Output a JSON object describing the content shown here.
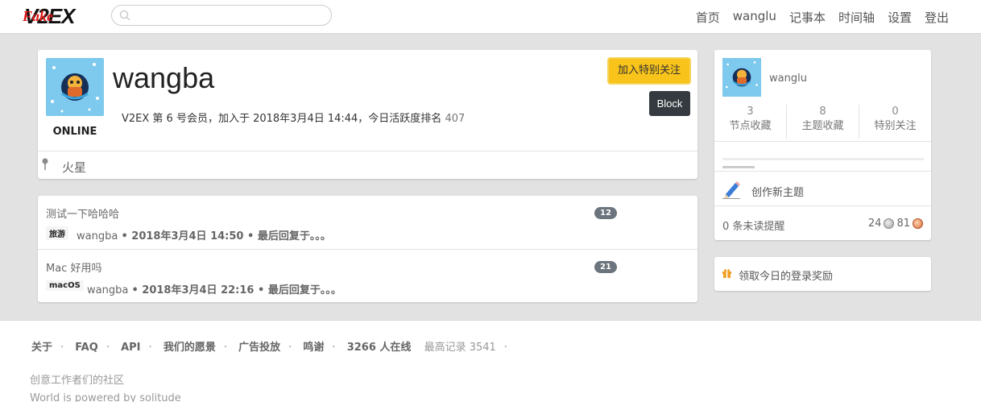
{
  "header": {
    "logo_text": "V2EX",
    "logo_overlay": "Fake",
    "search_placeholder": "",
    "nav": [
      "首页",
      "wanglu",
      "记事本",
      "时间轴",
      "设置",
      "登出"
    ]
  },
  "profile": {
    "username": "wangba",
    "status": "ONLINE",
    "meta_text": "V2EX 第 6 号会员，加入于 2018年3月4日 14:44，今日活跃度排名",
    "rank": "407",
    "follow_label": "加入特别关注",
    "block_label": "Block",
    "location": "火星"
  },
  "topics": [
    {
      "title": "测试一下哈哈哈",
      "replies": "12",
      "node": "旅游",
      "author": "wangba",
      "detail": "• 2018年3月4日 14:50 • 最后回复于。。。"
    },
    {
      "title": "Mac 好用吗",
      "replies": "21",
      "node": "macOS",
      "author": "wangba",
      "detail": "• 2018年3月4日 22:16 • 最后回复于。。。"
    }
  ],
  "sidebar": {
    "username": "wanglu",
    "stats": [
      {
        "num": "3",
        "label": "节点收藏"
      },
      {
        "num": "8",
        "label": "主题收藏"
      },
      {
        "num": "0",
        "label": "特别关注"
      }
    ],
    "progress": 0.16,
    "create_label": "创作新主题",
    "unread_label": "0 条未读提醒",
    "silver_count": "24",
    "bronze_count": "81",
    "reward_label": "领取今日的登录奖励"
  },
  "footer": {
    "links": [
      "关于",
      "FAQ",
      "API",
      "我们的愿景",
      "广告投放",
      "鸣谢"
    ],
    "online": "3266 人在线",
    "record": "最高记录 3541",
    "tagline": "创意工作者们的社区",
    "powered": "World is powered by solitude"
  },
  "colors": {
    "follow_button": "#f8c31a",
    "block_button": "#343a40",
    "badge": "#6c757d",
    "background": "#e2e2e2",
    "logo_red": "#e01a1a"
  }
}
